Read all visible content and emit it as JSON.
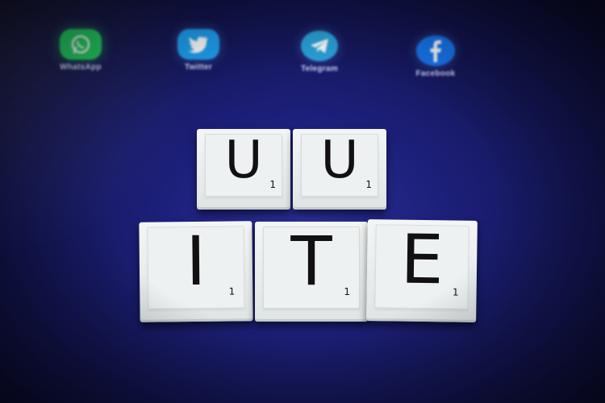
{
  "apps": [
    {
      "label": "WhatsApp",
      "icon": "whatsapp-icon",
      "color": "#25d366"
    },
    {
      "label": "Twitter",
      "icon": "twitter-icon",
      "color": "#1da1f2"
    },
    {
      "label": "Telegram",
      "icon": "telegram-icon",
      "color": "#2aa3dc"
    },
    {
      "label": "Facebook",
      "icon": "facebook-icon",
      "color": "#1877f2"
    }
  ],
  "tiles": {
    "row1": [
      {
        "letter": "U",
        "score": "1"
      },
      {
        "letter": "U",
        "score": "1"
      }
    ],
    "row2": [
      {
        "letter": "I",
        "score": "1"
      },
      {
        "letter": "T",
        "score": "1"
      },
      {
        "letter": "E",
        "score": "1"
      }
    ]
  },
  "colors": {
    "background": "#1c1f78",
    "tile": "#eef1f1",
    "tile_text": "#111111"
  }
}
